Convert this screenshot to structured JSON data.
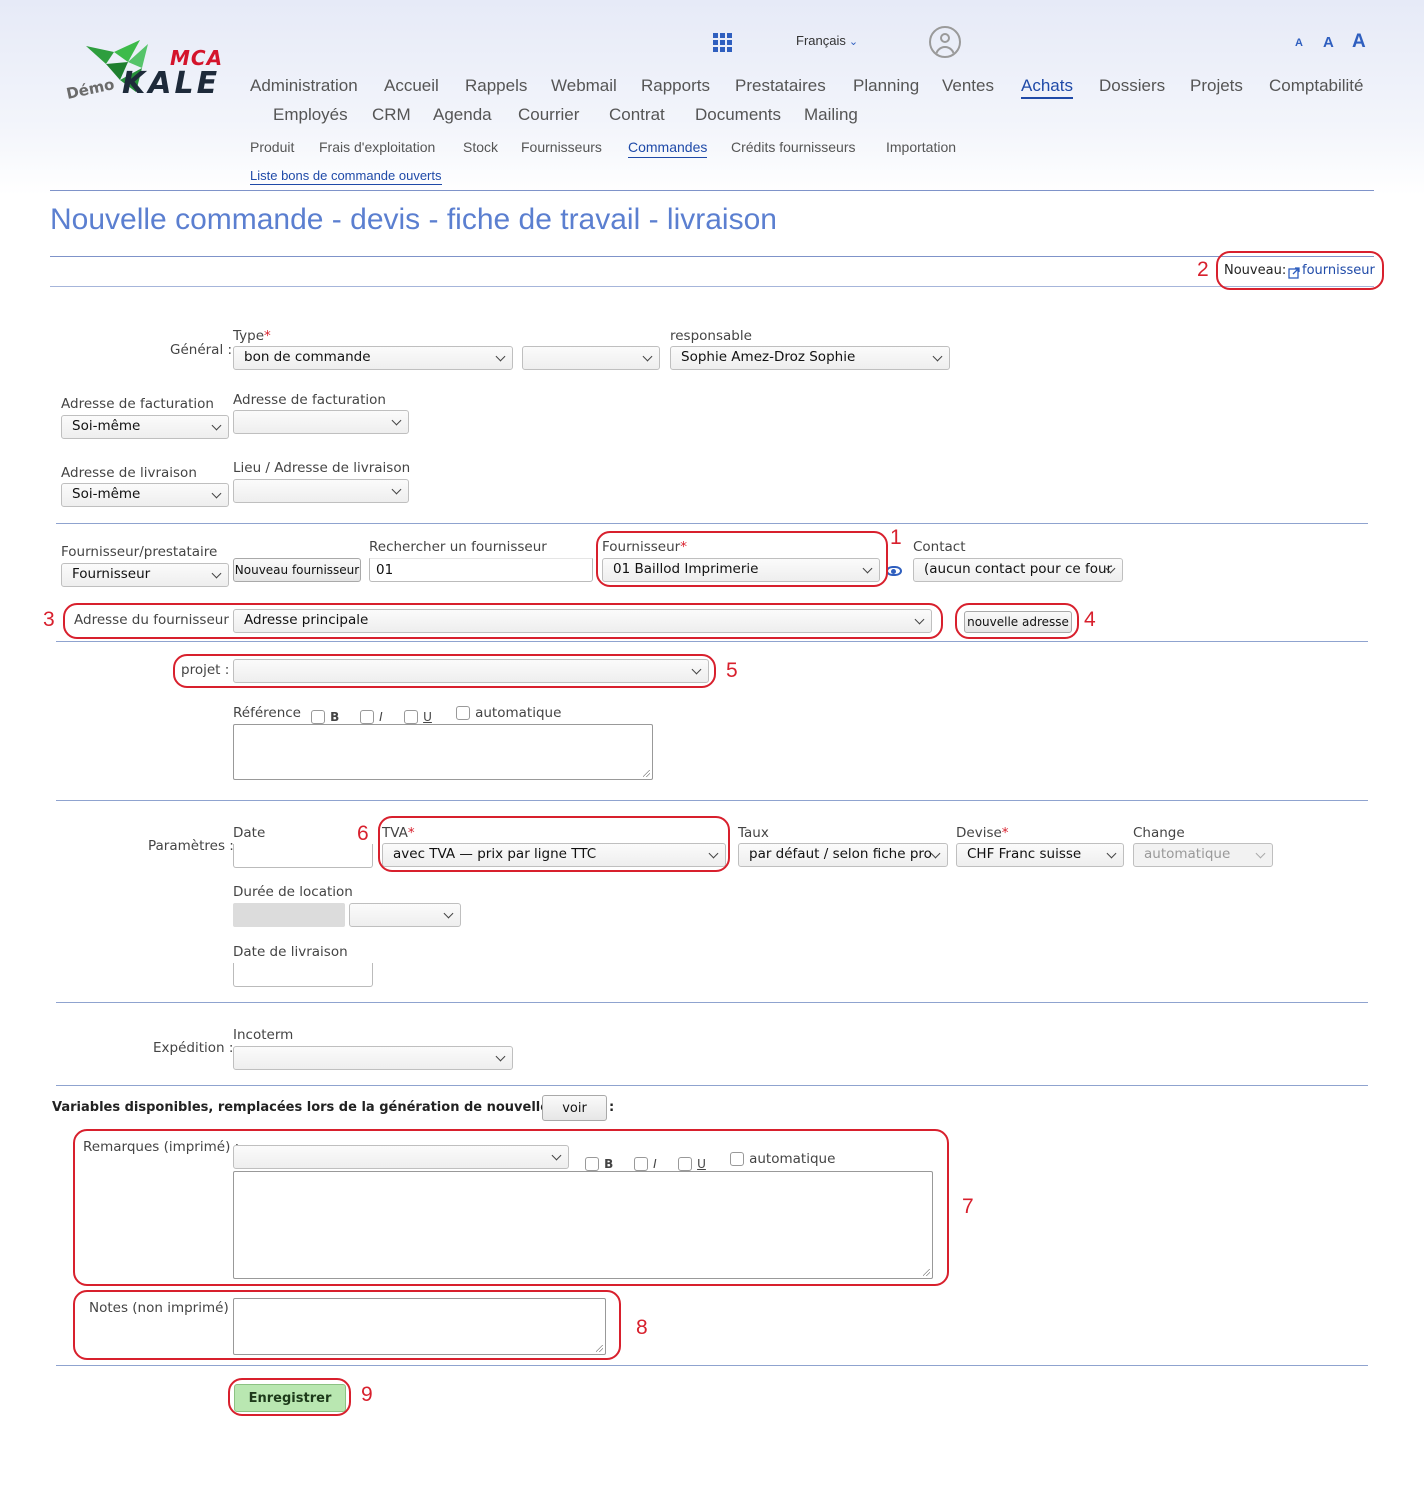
{
  "logo": {
    "brand_top": "MCA",
    "brand_main": "KALE",
    "brand_demo": "Démo"
  },
  "header": {
    "language": "Français",
    "font_sizes": [
      "A",
      "A",
      "A"
    ]
  },
  "nav": {
    "main": [
      "Administration",
      "Accueil",
      "Rappels",
      "Webmail",
      "Rapports",
      "Prestataires",
      "Planning",
      "Ventes",
      "Achats",
      "Dossiers",
      "Projets",
      "Comptabilité",
      "Employés",
      "CRM",
      "Agenda",
      "Courrier",
      "Contrat",
      "Documents",
      "Mailing"
    ],
    "main_active": "Achats",
    "sub": [
      "Produit",
      "Frais d'exploitation",
      "Stock",
      "Fournisseurs",
      "Commandes",
      "Crédits fournisseurs",
      "Importation"
    ],
    "sub_active": "Commandes",
    "third": "Liste bons de commande ouverts"
  },
  "page": {
    "title": "Nouvelle commande - devis - fiche de travail - livraison",
    "nouveau_label": "Nouveau:",
    "nouveau_link": "fournisseur"
  },
  "general": {
    "section_label": "Général :",
    "type_label": "Type",
    "type_value": "bon de commande",
    "type2_value": "",
    "responsable_label": "responsable",
    "responsable_value": "Sophie   Amez-Droz Sophie"
  },
  "billing": {
    "left_label": "Adresse de facturation",
    "left_value": "Soi-même",
    "right_label": "Adresse de facturation",
    "right_value": ""
  },
  "delivery": {
    "left_label": "Adresse de livraison",
    "left_value": "Soi-même",
    "right_label": "Lieu / Adresse de livraison",
    "right_value": ""
  },
  "supplier": {
    "type_label": "Fournisseur/prestataire",
    "type_value": "Fournisseur",
    "new_button": "Nouveau fournisseur",
    "search_label": "Rechercher un fournisseur",
    "search_value": "01",
    "supplier_label": "Fournisseur",
    "supplier_value": "01   Baillod Imprimerie",
    "contact_label": "Contact",
    "contact_value": "(aucun contact pour ce four",
    "address_label": "Adresse du fournisseur :",
    "address_value": "Adresse principale",
    "new_address_button": "nouvelle adresse"
  },
  "project": {
    "label": "projet :",
    "value": ""
  },
  "reference": {
    "label": "Référence",
    "bold": "B",
    "italic": "I",
    "underline": "U",
    "auto": "automatique"
  },
  "params": {
    "section_label": "Paramètres :",
    "date_label": "Date",
    "tva_label": "TVA",
    "tva_value": "avec TVA — prix par ligne TTC",
    "taux_label": "Taux",
    "taux_value": "par défaut / selon fiche pro",
    "devise_label": "Devise",
    "devise_value": "CHF   Franc suisse",
    "change_label": "Change",
    "change_value": "automatique",
    "duration_label": "Durée de location",
    "delivery_date_label": "Date de livraison"
  },
  "shipping": {
    "section_label": "Expédition :",
    "incoterm_label": "Incoterm",
    "incoterm_value": ""
  },
  "variables": {
    "text": "Variables disponibles, remplacées lors de la génération de nouvelles fiches :",
    "button": "voir"
  },
  "remarks": {
    "label": "Remarques (imprimé) :",
    "bold": "B",
    "italic": "I",
    "underline": "U",
    "auto": "automatique"
  },
  "notes": {
    "label": "Notes (non imprimé) :"
  },
  "save_button": "Enregistrer",
  "annotations": [
    "1",
    "2",
    "3",
    "4",
    "5",
    "6",
    "7",
    "8",
    "9"
  ],
  "colors": {
    "accent": "#1f4aa8",
    "title": "#5b7fd0",
    "annotation": "#d8202d",
    "save_bg": "#b9e7b1"
  }
}
